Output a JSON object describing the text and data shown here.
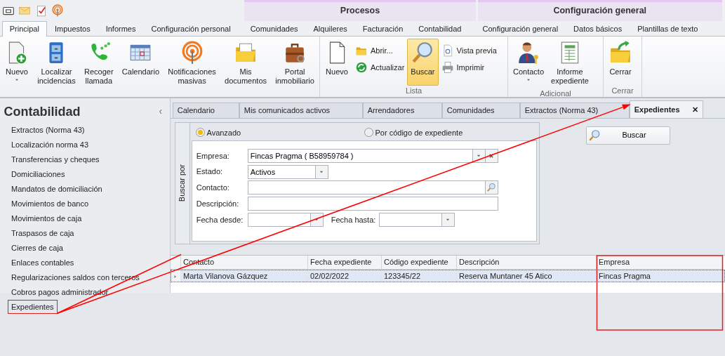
{
  "context_groups": [
    {
      "label": "Procesos"
    },
    {
      "label": "Configuración general"
    }
  ],
  "ribbon_tabs": [
    {
      "label": "Principal",
      "selected": true
    },
    {
      "label": "Impuestos",
      "selected": false
    },
    {
      "label": "Informes",
      "selected": false
    },
    {
      "label": "Configuración personal",
      "selected": false
    },
    {
      "label": "Comunidades",
      "selected": false
    },
    {
      "label": "Alquileres",
      "selected": false
    },
    {
      "label": "Facturación",
      "selected": false
    },
    {
      "label": "Contabilidad",
      "selected": false
    },
    {
      "label": "Configuración general",
      "selected": false
    },
    {
      "label": "Datos básicos",
      "selected": false
    },
    {
      "label": "Plantillas de texto",
      "selected": false
    }
  ],
  "ribbon_groups": [
    {
      "items": [
        {
          "kind": "large",
          "label": "Nuevo",
          "dropdown": true
        },
        {
          "kind": "large",
          "label": "Localizar incidencias"
        },
        {
          "kind": "large",
          "label": "Recoger llamada"
        },
        {
          "kind": "large",
          "label": "Calendario"
        },
        {
          "kind": "large",
          "label": "Notificaciones masivas"
        },
        {
          "kind": "large",
          "label": "Mis documentos"
        },
        {
          "kind": "large",
          "label": "Portal inmobiliario"
        }
      ]
    },
    {
      "label": "Lista",
      "items": [
        {
          "kind": "large",
          "label": "Nuevo"
        },
        {
          "kind": "small",
          "label": "Abrir..."
        },
        {
          "kind": "small",
          "label": "Actualizar"
        },
        {
          "kind": "large",
          "label": "Buscar",
          "selected": true
        },
        {
          "kind": "small",
          "label": "Vista previa"
        },
        {
          "kind": "small",
          "label": "Imprimir"
        }
      ]
    },
    {
      "label": "Adicional",
      "items": [
        {
          "kind": "large",
          "label": "Contacto",
          "dropdown": true
        },
        {
          "kind": "large",
          "label": "Informe expediente"
        }
      ]
    },
    {
      "label": "Cerrar",
      "items": [
        {
          "kind": "large",
          "label": "Cerrar"
        }
      ]
    }
  ],
  "sidebar": {
    "title": "Contabilidad",
    "collapse": "‹",
    "items": [
      {
        "label": "Extractos (Norma 43)",
        "highlighted": false
      },
      {
        "label": "Localización norma 43",
        "highlighted": false
      },
      {
        "label": "Transferencias y cheques",
        "highlighted": false
      },
      {
        "label": "Domiciliaciones",
        "highlighted": false
      },
      {
        "label": "Mandatos de domiciliación",
        "highlighted": false
      },
      {
        "label": "Movimientos de banco",
        "highlighted": false
      },
      {
        "label": "Movimientos de caja",
        "highlighted": false
      },
      {
        "label": "Traspasos de caja",
        "highlighted": false
      },
      {
        "label": "Cierres de caja",
        "highlighted": false
      },
      {
        "label": "Enlaces contables",
        "highlighted": false
      },
      {
        "label": "Regularizaciones saldos con terceros",
        "highlighted": false
      },
      {
        "label": "Cobros pagos administrador",
        "highlighted": false
      },
      {
        "label": "Expedientes",
        "highlighted": true
      }
    ]
  },
  "doc_tabs": [
    {
      "label": "Calendario",
      "selected": false
    },
    {
      "label": "Mis comunicados activos",
      "selected": false
    },
    {
      "label": "Arrendadores",
      "selected": false
    },
    {
      "label": "Comunidades",
      "selected": false
    },
    {
      "label": "Extractos (Norma 43)",
      "selected": false
    },
    {
      "label": "Expedientes",
      "selected": true,
      "close": "✕"
    }
  ],
  "search_panel": {
    "side_label": "Buscar por",
    "modes": [
      {
        "label": "Avanzado",
        "selected": true
      },
      {
        "label": "Por código de expediente",
        "selected": false
      }
    ],
    "rows": [
      [
        {
          "label": "Empresa:",
          "kind": "combo-clear",
          "value": "Fincas Pragma ( B58959784 )"
        }
      ],
      [
        {
          "label": "Estado:",
          "kind": "combo",
          "value": "Activos"
        }
      ],
      [
        {
          "label": "Contacto:",
          "kind": "search"
        }
      ],
      [
        {
          "label": "Descripción:",
          "kind": "text"
        }
      ],
      [
        {
          "label": "Fecha desde:",
          "kind": "date"
        },
        {
          "label": "Fecha hasta:",
          "kind": "date"
        }
      ]
    ],
    "button": "Buscar"
  },
  "grid": {
    "columns": [
      {
        "label": "Contacto",
        "highlighted": false
      },
      {
        "label": "Fecha expediente",
        "highlighted": false
      },
      {
        "label": "Código expediente",
        "highlighted": false
      },
      {
        "label": "Descripción",
        "highlighted": false
      },
      {
        "label": "Empresa",
        "highlighted": true
      }
    ],
    "rows": [
      {
        "selected": true,
        "cells": [
          "Marta Vilanova Gázquez",
          "02/02/2022",
          "123345/22",
          "Reserva Muntaner 45 Atico",
          "Fincas Pragma"
        ]
      }
    ]
  }
}
